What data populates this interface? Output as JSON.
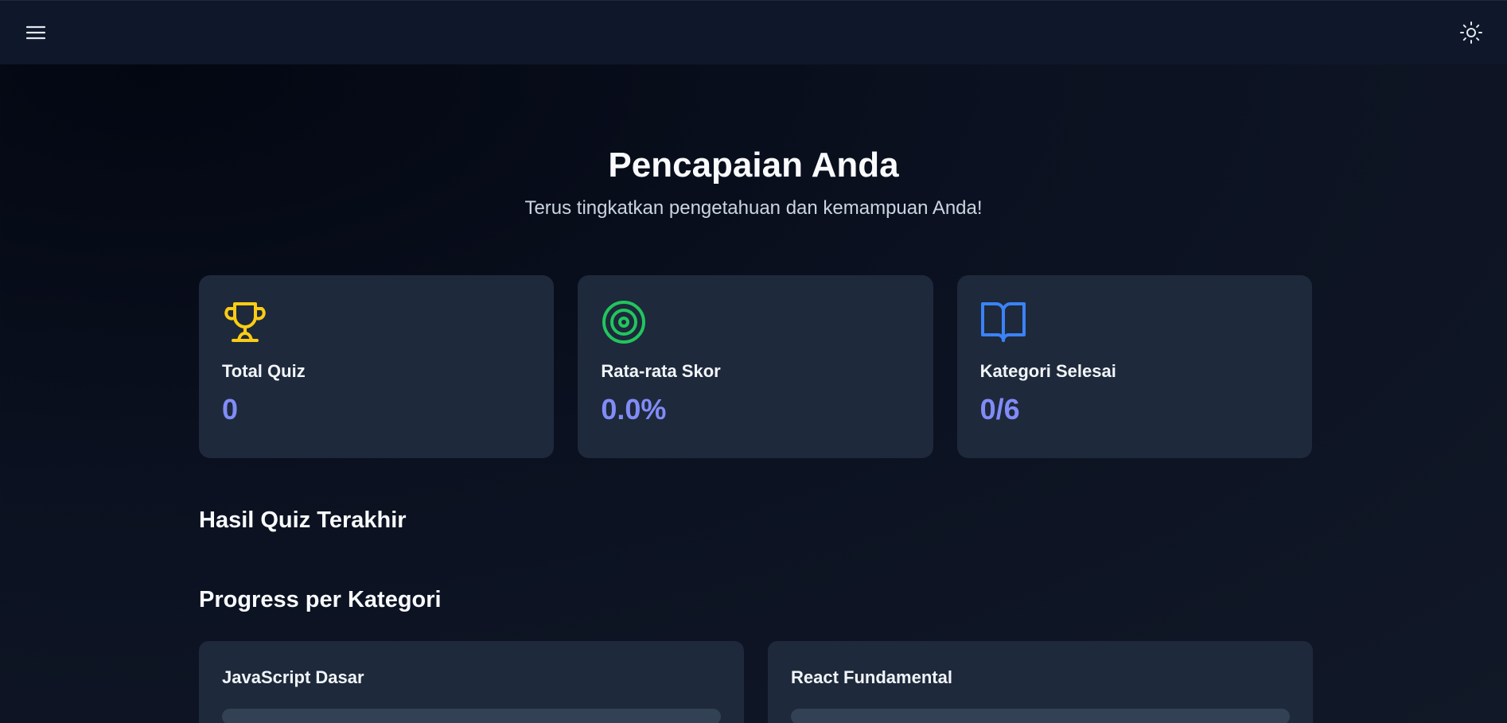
{
  "header": {
    "menu_icon": "hamburger-menu-icon",
    "theme_icon": "sun-icon"
  },
  "hero": {
    "title": "Pencapaian Anda",
    "subtitle": "Terus tingkatkan pengetahuan dan kemampuan Anda!"
  },
  "stats": [
    {
      "icon": "trophy-icon",
      "label": "Total Quiz",
      "value": "0",
      "color": "#facc15"
    },
    {
      "icon": "target-icon",
      "label": "Rata-rata Skor",
      "value": "0.0%",
      "color": "#22c55e"
    },
    {
      "icon": "book-open-icon",
      "label": "Kategori Selesai",
      "value": "0/6",
      "color": "#3b82f6"
    }
  ],
  "sections": {
    "recent_results": "Hasil Quiz Terakhir",
    "category_progress": "Progress per Kategori"
  },
  "categories": [
    {
      "name": "JavaScript Dasar",
      "progress": 0
    },
    {
      "name": "React Fundamental",
      "progress": 0
    }
  ],
  "colors": {
    "accent": "#818cf8",
    "card": "#1e293b"
  }
}
